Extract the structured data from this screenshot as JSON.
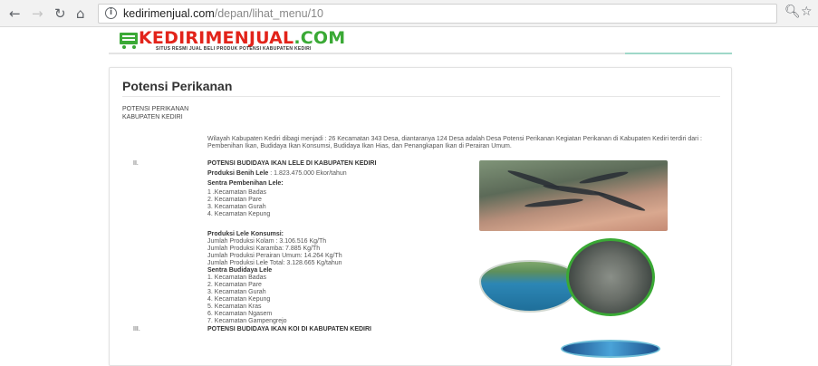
{
  "browser": {
    "url_domain": "kedirimenjual.com",
    "url_path": "/depan/lihat_menu/10",
    "info_icon": "info-icon",
    "icons": [
      "back-icon",
      "forward-icon",
      "reload-icon",
      "home-icon",
      "zoom-icon",
      "star-icon"
    ]
  },
  "site": {
    "logo_main": "KEDIRIMENJUAL",
    "logo_dot_com": ".COM",
    "logo_tagline": "SITUS RESMI JUAL BELI PRODUK POTENSI KABUPATEN KEDIRI"
  },
  "content": {
    "title": "Potensi Perikanan",
    "subheading_line1": "POTENSI PERIKANAN",
    "subheading_line2": "KABUPATEN KEDIRI",
    "intro": "Wilayah Kabupaten Kediri dibagi menjadi : 26 Kecamatan 343 Desa, diantaranya 124 Desa adalah Desa Potensi Perikanan Kegiatan Perikanan di Kabupaten Kediri terdiri dari : Pembenihan Ikan, Budidaya Ikan Konsumsi, Budidaya Ikan Hias, dan Penangkapan Ikan di Perairan Umum.",
    "section2": {
      "number": "II.",
      "heading": "POTENSI BUDIDAYA IKAN LELE DI KABUPATEN KEDIRI",
      "produksi_benih_label": "Produksi Benih Lele",
      "produksi_benih_value": " : 1.823.475.000 Ekor/tahun",
      "sentra_pembenihan": "Sentra Pembenihan Lele:",
      "pembenihan_list": [
        "1 .Kecamatan Badas",
        "2. Kecamatan Pare",
        "3. Kecamatan Gurah",
        "4. Kecamatan Kepung"
      ],
      "konsumsi_heading": "Produksi Lele Konsumsi:",
      "konsumsi_list": [
        "Jumlah Produksi Kolam : 3.106.516 Kg/Th",
        "Jumlah Produksi Karamba: 7.885 Kg/Th",
        "Jumlah Produksi Perairan Umum: 14.264 Kg/Th",
        "Jumlah Produksi Lele Total: 3.128.665 Kg/tahun"
      ],
      "sentra_budidaya": "Sentra Budidaya Lele",
      "budidaya_list": [
        "1. Kecamatan Badas",
        "2. Kecamatan Pare",
        "3. Kecamatan Gurah",
        "4. Kecamatan Kepung",
        "5. Kecamatan Kras",
        "6. Kecamatan Ngasem",
        "7. Kecamatan Gampengrejo"
      ]
    },
    "section3": {
      "number": "III.",
      "heading": "POTENSI BUDIDAYA IKAN KOI DI KABUPATEN KEDIRI"
    }
  }
}
